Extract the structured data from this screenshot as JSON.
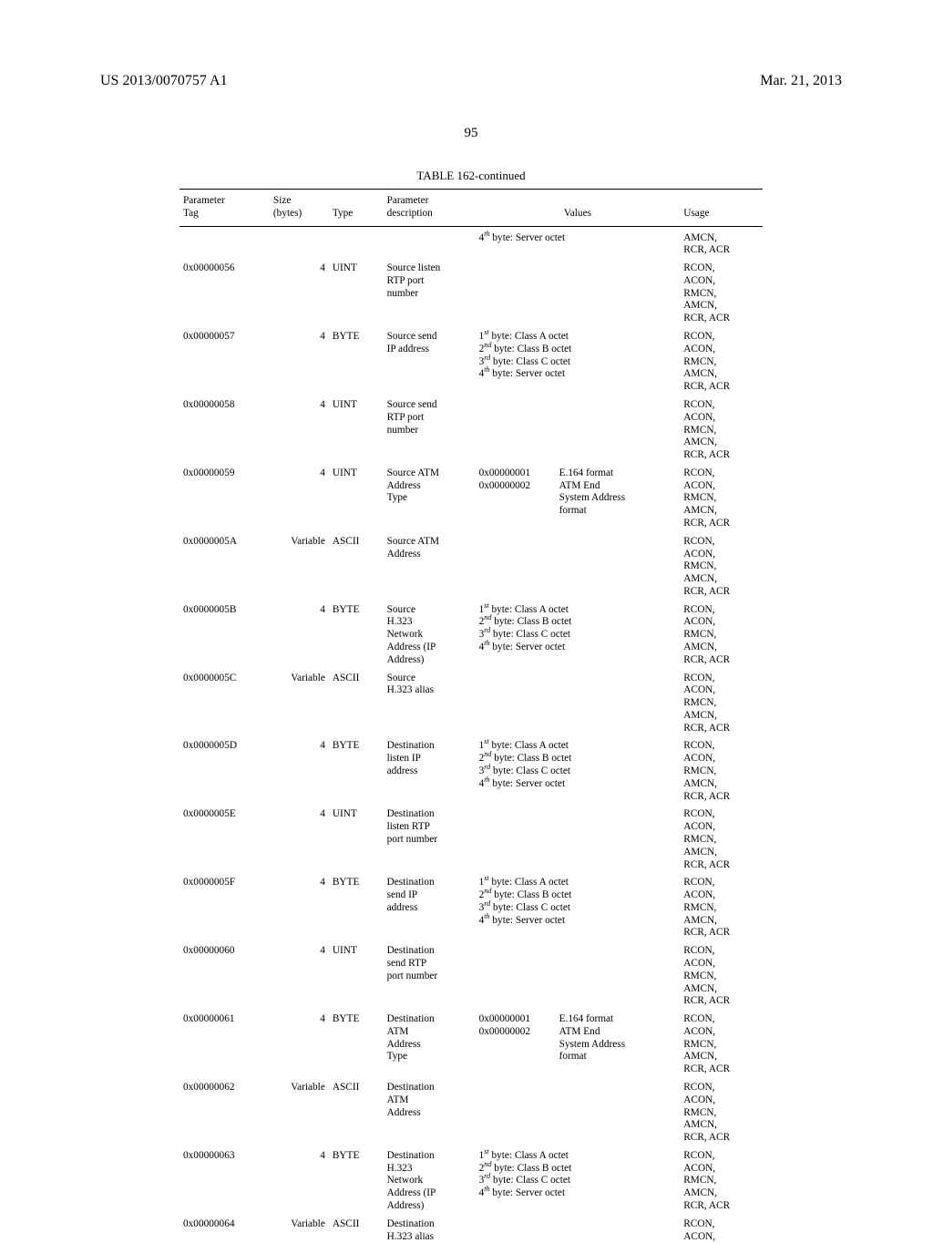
{
  "header": {
    "pub_number": "US 2013/0070757 A1",
    "pub_date": "Mar. 21, 2013"
  },
  "page_number": "95",
  "table_caption": "TABLE 162-continued",
  "columns": {
    "tag": "Parameter\nTag",
    "size": "Size\n(bytes)",
    "type": "Type",
    "desc": "Parameter\ndescription",
    "values": "Values",
    "usage": "Usage"
  },
  "rows": [
    {
      "tag": "",
      "size": "",
      "type": "",
      "desc": "",
      "values_lines": [
        "4<sup>th</sup> byte: Server octet"
      ],
      "usage_lines": [
        "AMCN,",
        "RCR, ACR"
      ]
    },
    {
      "tag": "0x00000056",
      "size": "4",
      "type": "UINT",
      "desc_lines": [
        "Source listen",
        "RTP port",
        "number"
      ],
      "values_lines": [],
      "usage_lines": [
        "RCON,",
        "ACON,",
        "RMCN,",
        "AMCN,",
        "RCR, ACR"
      ]
    },
    {
      "tag": "0x00000057",
      "size": "4",
      "type": "BYTE",
      "desc_lines": [
        "Source send",
        "IP address"
      ],
      "values_lines": [
        "1<sup>st</sup> byte: Class A octet",
        "2<sup>nd</sup> byte: Class B octet",
        "3<sup>rd</sup> byte: Class C octet",
        "4<sup>th</sup> byte: Server octet"
      ],
      "usage_lines": [
        "RCON,",
        "ACON,",
        "RMCN,",
        "AMCN,",
        "RCR, ACR"
      ]
    },
    {
      "tag": "0x00000058",
      "size": "4",
      "type": "UINT",
      "desc_lines": [
        "Source send",
        "RTP port",
        "number"
      ],
      "values_lines": [],
      "usage_lines": [
        "RCON,",
        "ACON,",
        "RMCN,",
        "AMCN,",
        "RCR, ACR"
      ]
    },
    {
      "tag": "0x00000059",
      "size": "4",
      "type": "UINT",
      "desc_lines": [
        "Source ATM",
        "Address",
        "Type"
      ],
      "values_cols": {
        "left": [
          "0x00000001",
          "0x00000002"
        ],
        "right": [
          "E.164 format",
          "ATM End",
          "System Address",
          "format"
        ]
      },
      "usage_lines": [
        "RCON,",
        "ACON,",
        "RMCN,",
        "AMCN,",
        "RCR, ACR"
      ]
    },
    {
      "tag": "0x0000005A",
      "size": "Variable",
      "type": "ASCII",
      "desc_lines": [
        "Source ATM",
        "Address"
      ],
      "values_lines": [],
      "usage_lines": [
        "RCON,",
        "ACON,",
        "RMCN,",
        "AMCN,",
        "RCR, ACR"
      ]
    },
    {
      "tag": "0x0000005B",
      "size": "4",
      "type": "BYTE",
      "desc_lines": [
        "Source",
        "H.323",
        "Network",
        "Address (IP",
        "Address)"
      ],
      "values_lines": [
        "1<sup>st</sup> byte: Class A octet",
        "2<sup>nd</sup> byte: Class B octet",
        "3<sup>rd</sup> byte: Class C octet",
        "4<sup>th</sup> byte: Server octet"
      ],
      "usage_lines": [
        "RCON,",
        "ACON,",
        "RMCN,",
        "AMCN,",
        "RCR, ACR"
      ]
    },
    {
      "tag": "0x0000005C",
      "size": "Variable",
      "type": "ASCII",
      "desc_lines": [
        "Source",
        "H.323 alias"
      ],
      "values_lines": [],
      "usage_lines": [
        "RCON,",
        "ACON,",
        "RMCN,",
        "AMCN,",
        "RCR, ACR"
      ]
    },
    {
      "tag": "0x0000005D",
      "size": "4",
      "type": "BYTE",
      "desc_lines": [
        "Destination",
        "listen IP",
        "address"
      ],
      "values_lines": [
        "1<sup>st</sup> byte: Class A octet",
        "2<sup>nd</sup> byte: Class B octet",
        "3<sup>rd</sup> byte: Class C octet",
        "4<sup>th</sup> byte: Server octet"
      ],
      "usage_lines": [
        "RCON,",
        "ACON,",
        "RMCN,",
        "AMCN,",
        "RCR, ACR"
      ]
    },
    {
      "tag": "0x0000005E",
      "size": "4",
      "type": "UINT",
      "desc_lines": [
        "Destination",
        "listen RTP",
        "port number"
      ],
      "values_lines": [],
      "usage_lines": [
        "RCON,",
        "ACON,",
        "RMCN,",
        "AMCN,",
        "RCR, ACR"
      ]
    },
    {
      "tag": "0x0000005F",
      "size": "4",
      "type": "BYTE",
      "desc_lines": [
        "Destination",
        "send IP",
        "address"
      ],
      "values_lines": [
        "1<sup>st</sup> byte: Class A octet",
        "2<sup>nd</sup> byte: Class B octet",
        "3<sup>rd</sup> byte: Class C octet",
        "4<sup>th</sup> byte: Server octet"
      ],
      "usage_lines": [
        "RCON,",
        "ACON,",
        "RMCN,",
        "AMCN,",
        "RCR, ACR"
      ]
    },
    {
      "tag": "0x00000060",
      "size": "4",
      "type": "UINT",
      "desc_lines": [
        "Destination",
        "send RTP",
        "port number"
      ],
      "values_lines": [],
      "usage_lines": [
        "RCON,",
        "ACON,",
        "RMCN,",
        "AMCN,",
        "RCR, ACR"
      ]
    },
    {
      "tag": "0x00000061",
      "size": "4",
      "type": "BYTE",
      "desc_lines": [
        "Destination",
        "ATM",
        "Address",
        "Type"
      ],
      "values_cols": {
        "left": [
          "0x00000001",
          "0x00000002"
        ],
        "right": [
          "E.164 format",
          "ATM End",
          "System Address",
          "format"
        ]
      },
      "usage_lines": [
        "RCON,",
        "ACON,",
        "RMCN,",
        "AMCN,",
        "RCR, ACR"
      ]
    },
    {
      "tag": "0x00000062",
      "size": "Variable",
      "type": "ASCII",
      "desc_lines": [
        "Destination",
        "ATM",
        "Address"
      ],
      "values_lines": [],
      "usage_lines": [
        "RCON,",
        "ACON,",
        "RMCN,",
        "AMCN,",
        "RCR, ACR"
      ]
    },
    {
      "tag": "0x00000063",
      "size": "4",
      "type": "BYTE",
      "desc_lines": [
        "Destination",
        "H.323",
        "Network",
        "Address (IP",
        "Address)"
      ],
      "values_lines": [
        "1<sup>st</sup> byte: Class A octet",
        "2<sup>nd</sup> byte: Class B octet",
        "3<sup>rd</sup> byte: Class C octet",
        "4<sup>th</sup> byte: Server octet"
      ],
      "usage_lines": [
        "RCON,",
        "ACON,",
        "RMCN,",
        "AMCN,",
        "RCR, ACR"
      ]
    },
    {
      "tag": "0x00000064",
      "size": "Variable",
      "type": "ASCII",
      "desc_lines": [
        "Destination",
        "H.323 alias"
      ],
      "values_lines": [],
      "usage_lines": [
        "RCON,",
        "ACON,"
      ]
    }
  ]
}
